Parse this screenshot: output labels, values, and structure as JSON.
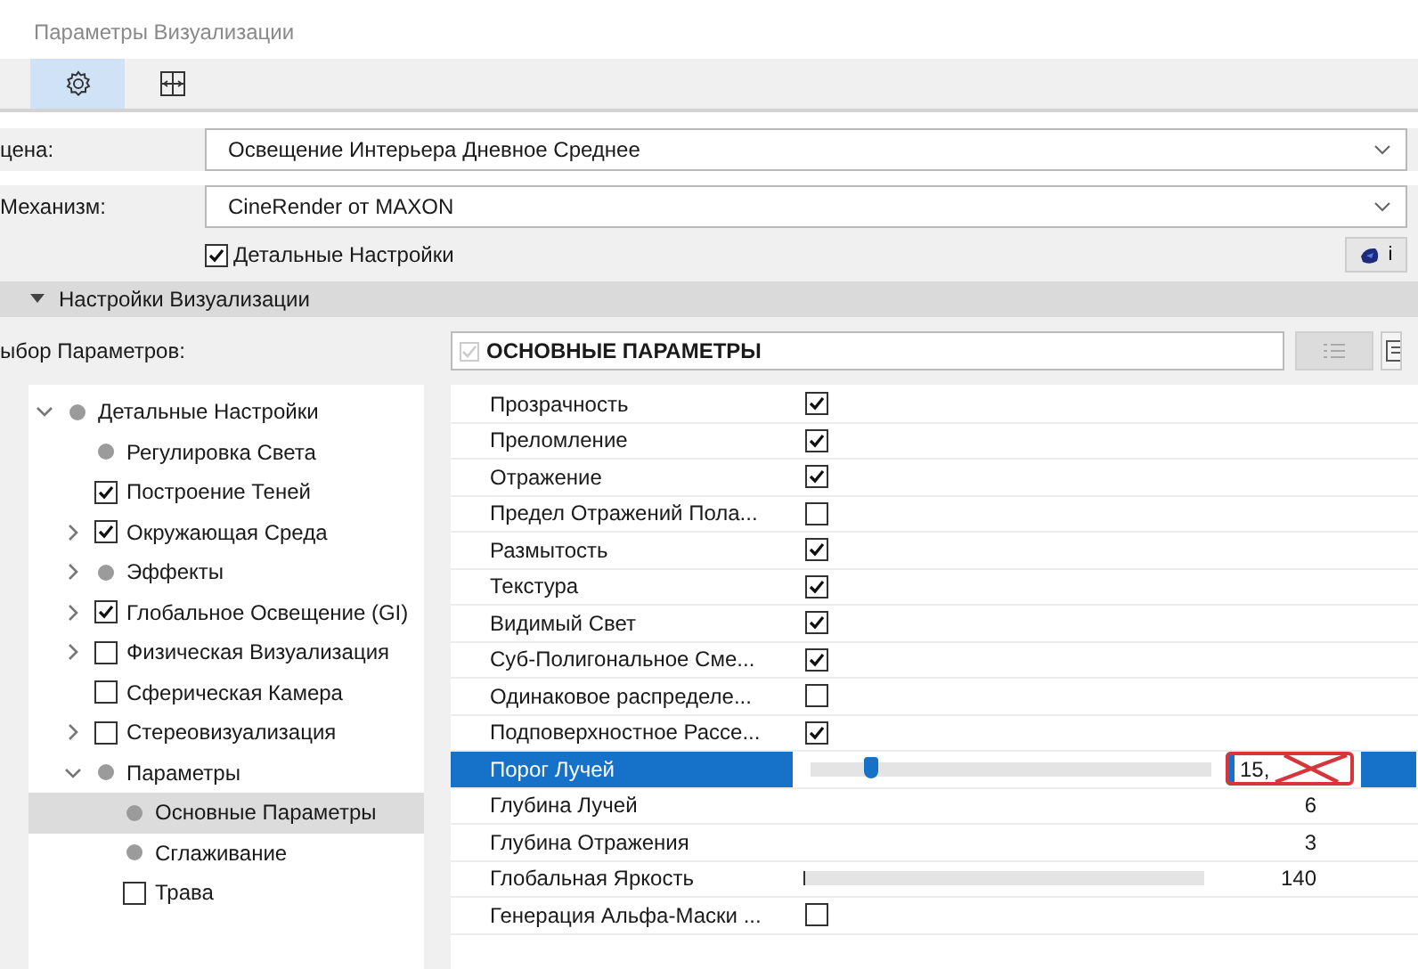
{
  "window": {
    "title": "Параметры Визуализации"
  },
  "toolbar": [
    {
      "kind": "gear",
      "selected": true
    },
    {
      "kind": "layout",
      "selected": false
    }
  ],
  "fields": [
    {
      "label": "цена:",
      "value": "Освещение Интерьера Дневное Среднее"
    },
    {
      "label": "Механизм:",
      "value": "CineRender от MAXON"
    }
  ],
  "detail_checkbox": {
    "label": "Детальные Настройки",
    "checked": true
  },
  "info_button": {
    "label": "i"
  },
  "section": {
    "title": "Настройки Визуализации",
    "expanded": true
  },
  "params_label": "ыбор Параметров:",
  "tree": [
    {
      "label": "Детальные Настройки",
      "kind": "dot",
      "expanded": true,
      "selected": false,
      "children": [
        {
          "label": "Регулировка Света",
          "kind": "dot",
          "selected": false
        },
        {
          "label": "Построение Теней",
          "kind": "check",
          "checked": true,
          "selected": false
        },
        {
          "label": "Окружающая Среда",
          "kind": "check",
          "checked": true,
          "expanded": false,
          "selected": false
        },
        {
          "label": "Эффекты",
          "kind": "dot",
          "expanded": false,
          "selected": false
        },
        {
          "label": "Глобальное Освещение (GI)",
          "kind": "check",
          "checked": true,
          "expanded": false,
          "selected": false
        },
        {
          "label": "Физическая Визуализация",
          "kind": "check",
          "checked": false,
          "expanded": false,
          "selected": false
        },
        {
          "label": "Сферическая Камера",
          "kind": "check",
          "checked": false,
          "selected": false
        },
        {
          "label": "Стереовизуализация",
          "kind": "check",
          "checked": false,
          "expanded": false,
          "selected": false
        },
        {
          "label": "Параметры",
          "kind": "dot",
          "expanded": true,
          "selected": false,
          "children": [
            {
              "label": "Основные Параметры",
              "kind": "dot",
              "selected": true
            },
            {
              "label": "Сглаживание",
              "kind": "dot",
              "selected": false
            },
            {
              "label": "Трава",
              "kind": "check",
              "checked": false,
              "selected": false
            }
          ]
        }
      ]
    }
  ],
  "panel": {
    "title": "ОСНОВНЫЕ ПАРАМЕТРЫ"
  },
  "rows": [
    {
      "label": "Прозрачность",
      "kind": "check",
      "checked": true,
      "selected": false
    },
    {
      "label": "Преломление",
      "kind": "check",
      "checked": true,
      "selected": false
    },
    {
      "label": "Отражение",
      "kind": "check",
      "checked": true,
      "selected": false
    },
    {
      "label": "Предел Отражений Пола...",
      "kind": "check",
      "checked": false,
      "selected": false
    },
    {
      "label": "Размытость",
      "kind": "check",
      "checked": true,
      "selected": false
    },
    {
      "label": "Текстура",
      "kind": "check",
      "checked": true,
      "selected": false
    },
    {
      "label": "Видимый Свет",
      "kind": "check",
      "checked": true,
      "selected": false
    },
    {
      "label": "Суб-Полигональное Сме...",
      "kind": "check",
      "checked": true,
      "selected": false
    },
    {
      "label": "Одинаковое распределе...",
      "kind": "check",
      "checked": false,
      "selected": false
    },
    {
      "label": "Подповерхностное Рассе...",
      "kind": "check",
      "checked": true,
      "selected": false
    },
    {
      "label": "Порог Лучей",
      "kind": "slider",
      "level": 0.15,
      "value": "15,",
      "selected": true
    },
    {
      "label": "Глубина Лучей",
      "kind": "number",
      "value": "6",
      "selected": false
    },
    {
      "label": "Глубина Отражения",
      "kind": "number",
      "value": "3",
      "selected": false
    },
    {
      "label": "Глобальная Яркость",
      "kind": "slider",
      "level": 0.0,
      "value": "140",
      "selected": false
    },
    {
      "label": "Генерация Альфа-Маски ...",
      "kind": "check",
      "checked": false,
      "selected": false
    }
  ]
}
